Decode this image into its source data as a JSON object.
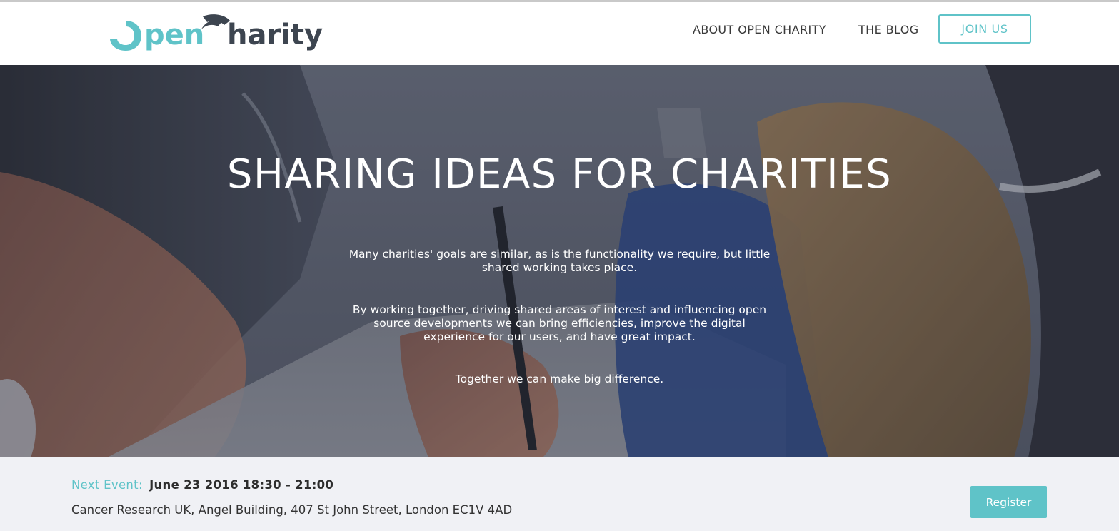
{
  "site": {
    "logo_text": "OpenCharity",
    "brand_color": "#5fc3c8",
    "dark_color": "#3d4550"
  },
  "nav": {
    "about_label": "ABOUT OPEN CHARITY",
    "blog_label": "THE BLOG",
    "join_label": "JOIN US"
  },
  "hero": {
    "title": "SHARING IDEAS FOR CHARITIES",
    "paragraphs": [
      "Many charities' goals are similar, as is the functionality we require, but little shared working takes place.",
      "By working together, driving shared areas of interest and influencing open source developments we can bring efficiencies, improve the digital experience for our users, and have great impact.",
      "Together we can make big difference."
    ]
  },
  "event": {
    "label": "Next Event:",
    "date": "June 23 2016 18:30 - 21:00",
    "address": "Cancer Research UK, Angel Building, 407 St John Street, London EC1V 4AD",
    "register_label": "Register"
  }
}
